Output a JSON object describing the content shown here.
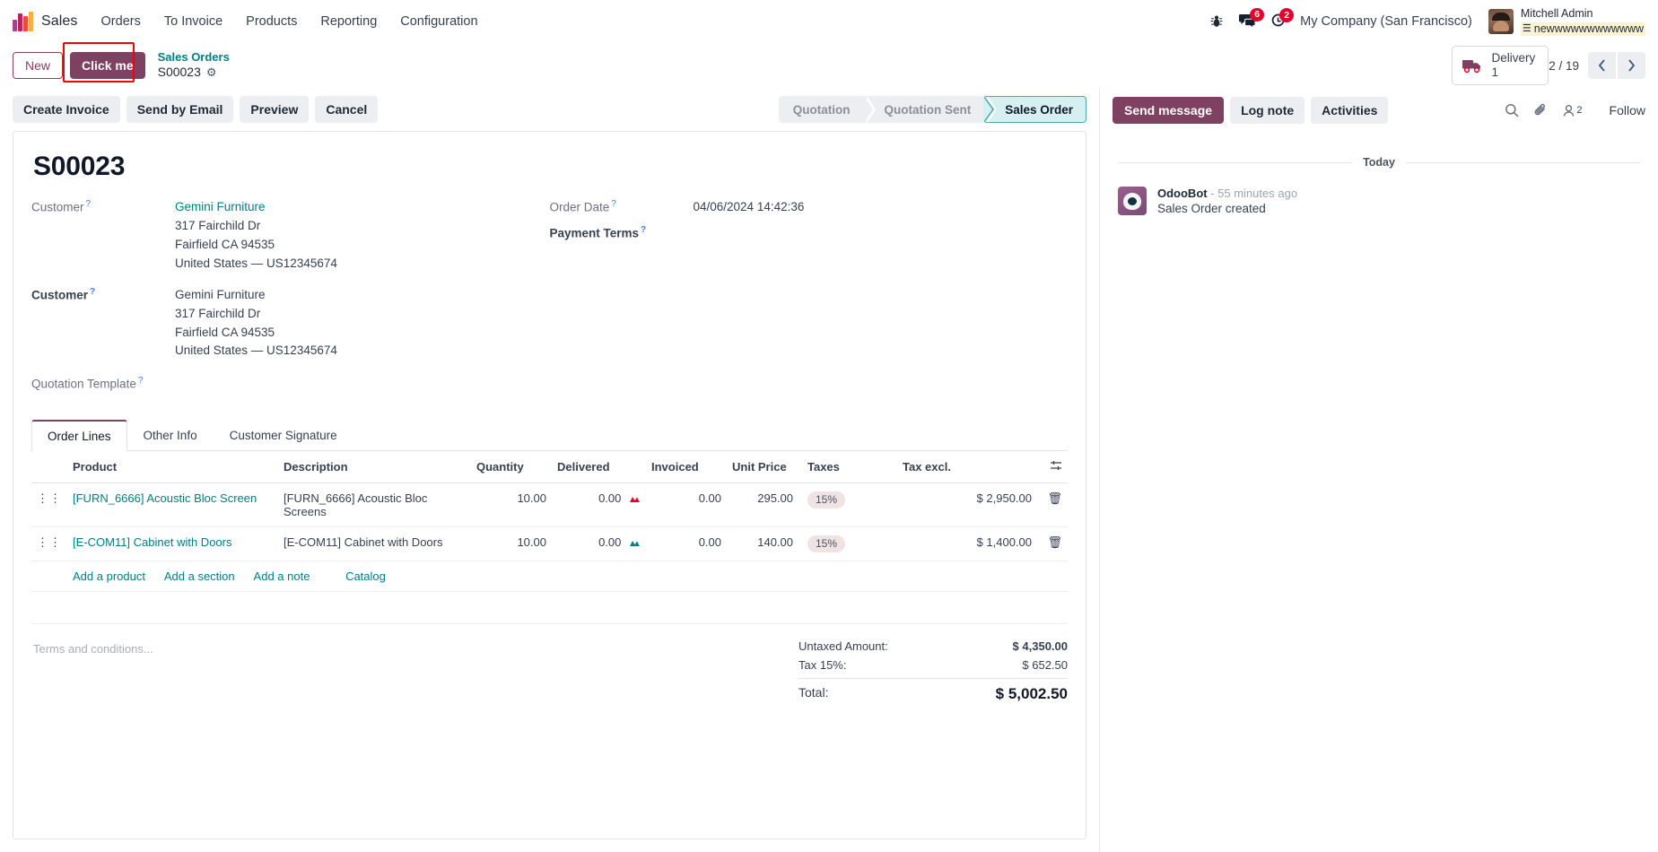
{
  "navbar": {
    "brand_icon": "odoo-sales-logo-icon",
    "app_name": "Sales",
    "menu": [
      {
        "label": "Orders"
      },
      {
        "label": "To Invoice"
      },
      {
        "label": "Products"
      },
      {
        "label": "Reporting"
      },
      {
        "label": "Configuration"
      }
    ],
    "sys_icons": [
      {
        "name": "bug-icon",
        "glyph": "🐞",
        "badge": ""
      },
      {
        "name": "messages-icon",
        "glyph": "",
        "badge": "6"
      },
      {
        "name": "activities-clock-icon",
        "glyph": "",
        "badge": "2"
      }
    ],
    "company": "My Company (San Francisco)",
    "user": {
      "name": "Mitchell Admin",
      "sub": "newwwwwwwwwwww",
      "sub_icon": "document-icon"
    }
  },
  "control_panel": {
    "new_label": "New",
    "click_me_label": "Click me",
    "breadcrumb_parent": "Sales Orders",
    "breadcrumb_current": "S00023",
    "gear_icon": "gear-icon",
    "stat_button": {
      "icon": "delivery-truck-icon",
      "label": "Delivery",
      "value": "1"
    },
    "pager": {
      "count": "2 / 19",
      "prev_icon": "chevron-left-icon",
      "next_icon": "chevron-right-icon"
    }
  },
  "action_bar": {
    "buttons": [
      {
        "label": "Create Invoice"
      },
      {
        "label": "Send by Email"
      },
      {
        "label": "Preview"
      },
      {
        "label": "Cancel"
      }
    ],
    "statuses": [
      {
        "label": "Quotation",
        "active": false
      },
      {
        "label": "Quotation Sent",
        "active": false
      },
      {
        "label": "Sales Order",
        "active": true
      }
    ]
  },
  "record": {
    "title": "S00023",
    "fields_left": [
      {
        "label": "Customer",
        "bold": false,
        "link": "Gemini Furniture",
        "lines": [
          "317 Fairchild Dr",
          "Fairfield CA 94535",
          "United States — US12345674"
        ]
      },
      {
        "label": "Customer",
        "bold": true,
        "link": "",
        "value_first": "Gemini Furniture",
        "lines": [
          "317 Fairchild Dr",
          "Fairfield CA 94535",
          "United States — US12345674"
        ]
      },
      {
        "label": "Quotation Template",
        "bold": false,
        "link": "",
        "value_first": "",
        "lines": []
      }
    ],
    "fields_right": [
      {
        "label": "Order Date",
        "bold": false,
        "value": "04/06/2024 14:42:36"
      },
      {
        "label": "Payment Terms",
        "bold": true,
        "value": ""
      }
    ]
  },
  "notebook": {
    "tabs": [
      {
        "label": "Order Lines",
        "active": true
      },
      {
        "label": "Other Info",
        "active": false
      },
      {
        "label": "Customer Signature",
        "active": false
      }
    ],
    "columns": [
      "Product",
      "Description",
      "Quantity",
      "Delivered",
      "Invoiced",
      "Unit Price",
      "Taxes",
      "Tax excl."
    ],
    "optional_columns_icon": "column-settings-icon",
    "rows": [
      {
        "drag_icon": "drag-handle-icon",
        "product": "[FURN_6666] Acoustic Bloc Screen",
        "description": "[FURN_6666] Acoustic Bloc Screens",
        "quantity": "10.00",
        "delivered": "0.00",
        "delivered_chart_icon": "forecast-chart-icon-red",
        "delivered_chart_color": "#e4022a",
        "invoiced": "0.00",
        "unit_price": "295.00",
        "taxes": "15%",
        "tax_excl": "$ 2,950.00",
        "delete_icon": "trash-icon"
      },
      {
        "drag_icon": "drag-handle-icon",
        "product": "[E-COM11] Cabinet with Doors",
        "description": "[E-COM11] Cabinet with Doors",
        "quantity": "10.00",
        "delivered": "0.00",
        "delivered_chart_icon": "forecast-chart-icon-teal",
        "delivered_chart_color": "#0e7c86",
        "invoiced": "0.00",
        "unit_price": "140.00",
        "taxes": "15%",
        "tax_excl": "$ 1,400.00",
        "delete_icon": "trash-icon"
      }
    ],
    "add_links": [
      {
        "label": "Add a product"
      },
      {
        "label": "Add a section"
      },
      {
        "label": "Add a note"
      },
      {
        "label": "Catalog"
      }
    ]
  },
  "footer": {
    "terms_placeholder": "Terms and conditions...",
    "totals": [
      {
        "label": "Untaxed Amount:",
        "value": "$ 4,350.00",
        "kind": "untaxed"
      },
      {
        "label": "Tax 15%:",
        "value": "$ 652.50",
        "kind": "tax"
      },
      {
        "label": "Total:",
        "value": "$ 5,002.50",
        "kind": "total"
      }
    ]
  },
  "chatter": {
    "send_message_label": "Send message",
    "log_note_label": "Log note",
    "activities_label": "Activities",
    "search_icon": "search-icon",
    "attachment_icon": "paperclip-icon",
    "followers_icon": "followers-icon",
    "followers_count": "2",
    "follow_label": "Follow",
    "day_separator": "Today",
    "messages": [
      {
        "avatar": "odoobot-avatar",
        "author": "OdooBot",
        "time": "- 55 minutes ago",
        "body": "Sales Order created"
      }
    ]
  },
  "colors": {
    "brand_purple": "#7f4161",
    "teal_link": "#017e84",
    "badge_red": "#e4022a",
    "status_active_bg": "#d6f0f1",
    "status_active_border": "#4aa9ad",
    "highlight_outline": "#f80000"
  }
}
